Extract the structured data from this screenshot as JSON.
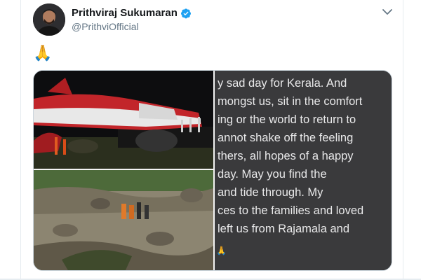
{
  "author": {
    "display_name": "Prithviraj Sukumaran",
    "handle": "@PrithviOfficial",
    "verified": true
  },
  "tweet": {
    "text": "🙏",
    "image_text_lines": [
      "y sad day for Kerala. And",
      "mongst us, sit in the comfort",
      "ing or the world to return to",
      "annot shake off the feeling",
      "thers, all hopes of a happy",
      "day. May you find the",
      "and tide through. My",
      "ces to the families and loved",
      "left us from Rajamala and",
      "🙏"
    ]
  },
  "icons": {
    "verified": "verified-badge-icon",
    "caret": "chevron-down-icon"
  },
  "colors": {
    "verified_blue": "#1da1f2",
    "name": "#14171a",
    "handle": "#657786"
  }
}
